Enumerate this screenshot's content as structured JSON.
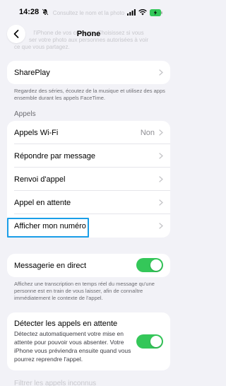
{
  "status_bar": {
    "time": "14:28"
  },
  "ghost_text": {
    "line1": "Consultez le nom et la photo",
    "line2": "l'iPhone de vos contacts. Choisissez si vous",
    "line3": "ser votre photo aux personnes autorisées à voir",
    "line4": "ce que vous partagez."
  },
  "nav": {
    "title": "Phone",
    "back_icon": "chevron-left-icon"
  },
  "shareplay": {
    "label": "SharePlay",
    "footer": "Regardez des séries, écoutez de la musique et utilisez des apps ensemble durant les appels FaceTime."
  },
  "calls_section": {
    "header": "Appels",
    "rows": [
      {
        "label": "Appels Wi-Fi",
        "value": "Non"
      },
      {
        "label": "Répondre par message"
      },
      {
        "label": "Renvoi d'appel"
      },
      {
        "label": "Appel en attente"
      },
      {
        "label": "Afficher mon numéro"
      }
    ]
  },
  "live_voicemail": {
    "label": "Messagerie en direct",
    "on": true,
    "footer": "Affichez une transcription en temps réel du message qu'une personne est en train de vous laisser, afin de connaître immédiatement le contexte de l'appel."
  },
  "hold_detection": {
    "label": "Détecter les appels en attente",
    "description": "Détectez automatiquement votre mise en attente pour pouvoir vous absenter. Votre iPhone vous préviendra ensuite quand vous pourrez reprendre l'appel.",
    "on": true
  },
  "bottom_ghost": "Filtrer les appels inconnus",
  "colors": {
    "toggle_on": "#34c759",
    "highlight": "#1a9ee8",
    "background": "#f2f2f7"
  }
}
